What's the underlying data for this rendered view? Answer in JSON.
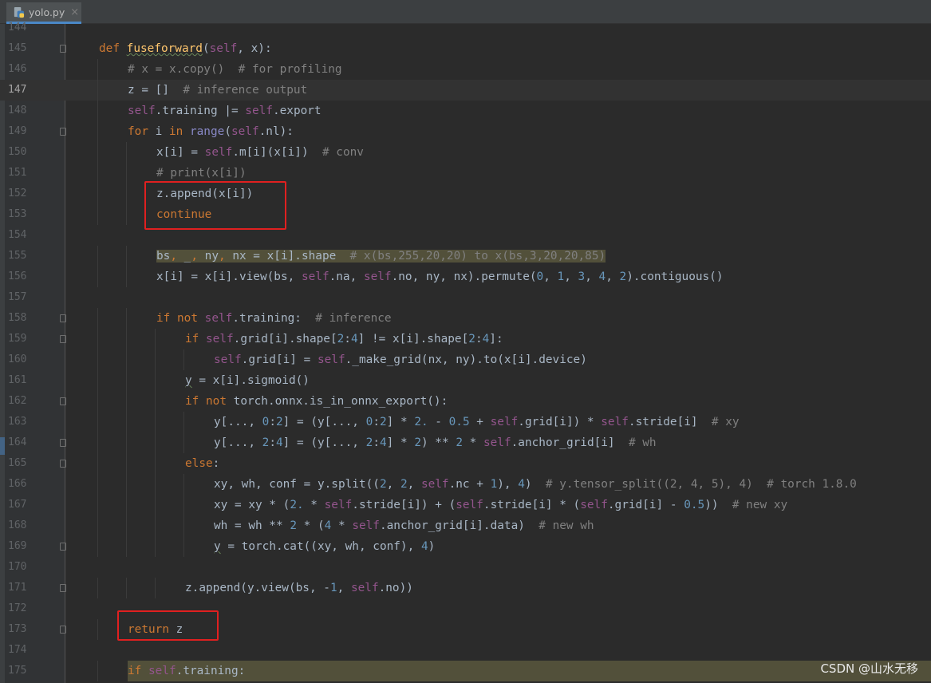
{
  "tab": {
    "filename": "yolo.py",
    "close": "×",
    "icon": "python-file-icon"
  },
  "watermark": "CSDN @山水无移",
  "current_line": "147",
  "lines": [
    {
      "n": "144",
      "indent": 0,
      "tokens": []
    },
    {
      "n": "145",
      "indent": 1,
      "fold": true,
      "tokens": [
        [
          "kw",
          "def "
        ],
        [
          "fn squig",
          "fuseforward"
        ],
        [
          "",
          "("
        ],
        [
          "self",
          "self"
        ],
        [
          "",
          ", x):"
        ]
      ]
    },
    {
      "n": "146",
      "indent": 2,
      "tokens": [
        [
          "cm",
          "# x = x.copy()  # for profiling"
        ]
      ]
    },
    {
      "n": "147",
      "indent": 2,
      "tokens": [
        [
          "",
          "z = []  "
        ],
        [
          "cm",
          "# inference output"
        ]
      ]
    },
    {
      "n": "148",
      "indent": 2,
      "tokens": [
        [
          "self",
          "self"
        ],
        [
          "",
          ".training |= "
        ],
        [
          "self",
          "self"
        ],
        [
          "",
          ".export"
        ]
      ]
    },
    {
      "n": "149",
      "indent": 2,
      "fold": true,
      "tokens": [
        [
          "kw",
          "for "
        ],
        [
          "",
          "i "
        ],
        [
          "kw",
          "in "
        ],
        [
          "bi",
          "range"
        ],
        [
          "",
          "("
        ],
        [
          "self",
          "self"
        ],
        [
          "",
          ".nl):"
        ]
      ]
    },
    {
      "n": "150",
      "indent": 3,
      "tokens": [
        [
          "",
          "x[i] = "
        ],
        [
          "self",
          "self"
        ],
        [
          "",
          ".m[i](x[i])  "
        ],
        [
          "cm",
          "# conv"
        ]
      ]
    },
    {
      "n": "151",
      "indent": 3,
      "tokens": [
        [
          "cm",
          "# print(x[i])"
        ]
      ]
    },
    {
      "n": "152",
      "indent": 3,
      "tokens": [
        [
          "",
          "z.append(x[i])"
        ]
      ]
    },
    {
      "n": "153",
      "indent": 3,
      "tokens": [
        [
          "kw",
          "continue"
        ]
      ]
    },
    {
      "n": "154",
      "indent": 0,
      "tokens": []
    },
    {
      "n": "155",
      "indent": 3,
      "tokens": [
        [
          "hl",
          "bs"
        ],
        [
          "hl kw",
          ", "
        ],
        [
          "hl",
          "_"
        ],
        [
          "hl kw",
          ", "
        ],
        [
          "hl",
          "ny"
        ],
        [
          "hl kw",
          ", "
        ],
        [
          "hl",
          "nx = x[i].shape  "
        ],
        [
          "hl cm",
          "# x(bs,255,20,20) to x(bs,3,20,20,85)"
        ]
      ]
    },
    {
      "n": "156",
      "indent": 3,
      "tokens": [
        [
          "",
          "x[i] = x[i].view(bs, "
        ],
        [
          "self",
          "self"
        ],
        [
          "",
          ".na, "
        ],
        [
          "self",
          "self"
        ],
        [
          "",
          ".no, ny, nx).permute("
        ],
        [
          "num",
          "0"
        ],
        [
          "",
          ", "
        ],
        [
          "num",
          "1"
        ],
        [
          "",
          ", "
        ],
        [
          "num",
          "3"
        ],
        [
          "",
          ", "
        ],
        [
          "num",
          "4"
        ],
        [
          "",
          ", "
        ],
        [
          "num",
          "2"
        ],
        [
          "",
          ").contiguous()"
        ]
      ]
    },
    {
      "n": "157",
      "indent": 0,
      "tokens": []
    },
    {
      "n": "158",
      "indent": 3,
      "fold": true,
      "tokens": [
        [
          "kw",
          "if not "
        ],
        [
          "self",
          "self"
        ],
        [
          "",
          ".training:  "
        ],
        [
          "cm",
          "# inference"
        ]
      ]
    },
    {
      "n": "159",
      "indent": 4,
      "fold": true,
      "tokens": [
        [
          "kw",
          "if "
        ],
        [
          "self",
          "self"
        ],
        [
          "",
          ".grid[i].shape["
        ],
        [
          "num",
          "2"
        ],
        [
          "",
          ":"
        ],
        [
          "num",
          "4"
        ],
        [
          "",
          "] != x[i].shape["
        ],
        [
          "num",
          "2"
        ],
        [
          "",
          ":"
        ],
        [
          "num",
          "4"
        ],
        [
          "",
          "]:"
        ]
      ]
    },
    {
      "n": "160",
      "indent": 5,
      "tokens": [
        [
          "self",
          "self"
        ],
        [
          "",
          ".grid[i] = "
        ],
        [
          "self",
          "self"
        ],
        [
          "",
          "._make_grid(nx, ny).to(x[i].device)"
        ]
      ]
    },
    {
      "n": "161",
      "indent": 4,
      "tokens": [
        [
          "squig",
          "y"
        ],
        [
          "",
          " = x[i].sigmoid()"
        ]
      ]
    },
    {
      "n": "162",
      "indent": 4,
      "fold": true,
      "tokens": [
        [
          "kw",
          "if not "
        ],
        [
          "",
          "torch.onnx.is_in_onnx_export():"
        ]
      ]
    },
    {
      "n": "163",
      "indent": 5,
      "tokens": [
        [
          "",
          "y[..., "
        ],
        [
          "num",
          "0"
        ],
        [
          "",
          ":"
        ],
        [
          "num",
          "2"
        ],
        [
          "",
          "] = (y[..., "
        ],
        [
          "num",
          "0"
        ],
        [
          "",
          ":"
        ],
        [
          "num",
          "2"
        ],
        [
          "",
          "] * "
        ],
        [
          "num",
          "2."
        ],
        [
          "",
          " - "
        ],
        [
          "num",
          "0.5"
        ],
        [
          "",
          " + "
        ],
        [
          "self",
          "self"
        ],
        [
          "",
          ".grid[i]) * "
        ],
        [
          "self",
          "self"
        ],
        [
          "",
          ".stride[i]  "
        ],
        [
          "cm",
          "# xy"
        ]
      ]
    },
    {
      "n": "164",
      "indent": 5,
      "fold": true,
      "tokens": [
        [
          "",
          "y[..., "
        ],
        [
          "num",
          "2"
        ],
        [
          "",
          ":"
        ],
        [
          "num",
          "4"
        ],
        [
          "",
          "] = (y[..., "
        ],
        [
          "num",
          "2"
        ],
        [
          "",
          ":"
        ],
        [
          "num",
          "4"
        ],
        [
          "",
          "] * "
        ],
        [
          "num",
          "2"
        ],
        [
          "",
          ") ** "
        ],
        [
          "num",
          "2"
        ],
        [
          "",
          " * "
        ],
        [
          "self",
          "self"
        ],
        [
          "",
          ".anchor_grid[i]  "
        ],
        [
          "cm",
          "# wh"
        ]
      ]
    },
    {
      "n": "165",
      "indent": 4,
      "fold": true,
      "tokens": [
        [
          "kw",
          "else"
        ],
        [
          "",
          ":"
        ]
      ]
    },
    {
      "n": "166",
      "indent": 5,
      "tokens": [
        [
          "",
          "xy, wh, conf = y.split(("
        ],
        [
          "num",
          "2"
        ],
        [
          "",
          ", "
        ],
        [
          "num",
          "2"
        ],
        [
          "",
          ", "
        ],
        [
          "self",
          "self"
        ],
        [
          "",
          ".nc + "
        ],
        [
          "num",
          "1"
        ],
        [
          "",
          "), "
        ],
        [
          "num",
          "4"
        ],
        [
          "",
          ")  "
        ],
        [
          "cm",
          "# y.tensor_split((2, 4, 5), 4)  # torch 1.8.0"
        ]
      ]
    },
    {
      "n": "167",
      "indent": 5,
      "tokens": [
        [
          "",
          "xy = xy * ("
        ],
        [
          "num",
          "2."
        ],
        [
          "",
          " * "
        ],
        [
          "self",
          "self"
        ],
        [
          "",
          ".stride[i]) + ("
        ],
        [
          "self",
          "self"
        ],
        [
          "",
          ".stride[i] * ("
        ],
        [
          "self",
          "self"
        ],
        [
          "",
          ".grid[i] - "
        ],
        [
          "num",
          "0.5"
        ],
        [
          "",
          "))  "
        ],
        [
          "cm",
          "# new xy"
        ]
      ]
    },
    {
      "n": "168",
      "indent": 5,
      "tokens": [
        [
          "",
          "wh = wh ** "
        ],
        [
          "num",
          "2"
        ],
        [
          "",
          " * ("
        ],
        [
          "num",
          "4"
        ],
        [
          "",
          " * "
        ],
        [
          "self",
          "self"
        ],
        [
          "",
          ".anchor_grid[i].data)  "
        ],
        [
          "cm",
          "# new wh"
        ]
      ]
    },
    {
      "n": "169",
      "indent": 5,
      "fold": true,
      "tokens": [
        [
          "squig",
          "y"
        ],
        [
          "",
          " = torch.cat((xy, wh, conf), "
        ],
        [
          "num",
          "4"
        ],
        [
          "",
          ")"
        ]
      ]
    },
    {
      "n": "170",
      "indent": 0,
      "tokens": []
    },
    {
      "n": "171",
      "indent": 4,
      "fold": true,
      "tokens": [
        [
          "",
          "z.append(y.view(bs, -"
        ],
        [
          "num",
          "1"
        ],
        [
          "",
          ", "
        ],
        [
          "self",
          "self"
        ],
        [
          "",
          ".no))"
        ]
      ]
    },
    {
      "n": "172",
      "indent": 0,
      "tokens": []
    },
    {
      "n": "173",
      "indent": 2,
      "fold": true,
      "tokens": [
        [
          "kw",
          "return "
        ],
        [
          "",
          "z"
        ]
      ]
    },
    {
      "n": "174",
      "indent": 0,
      "tokens": []
    },
    {
      "n": "175",
      "indent": 2,
      "hlline": true,
      "tokens": [
        [
          "kw",
          "if "
        ],
        [
          "self",
          "self"
        ],
        [
          "",
          ".training:"
        ]
      ]
    }
  ]
}
